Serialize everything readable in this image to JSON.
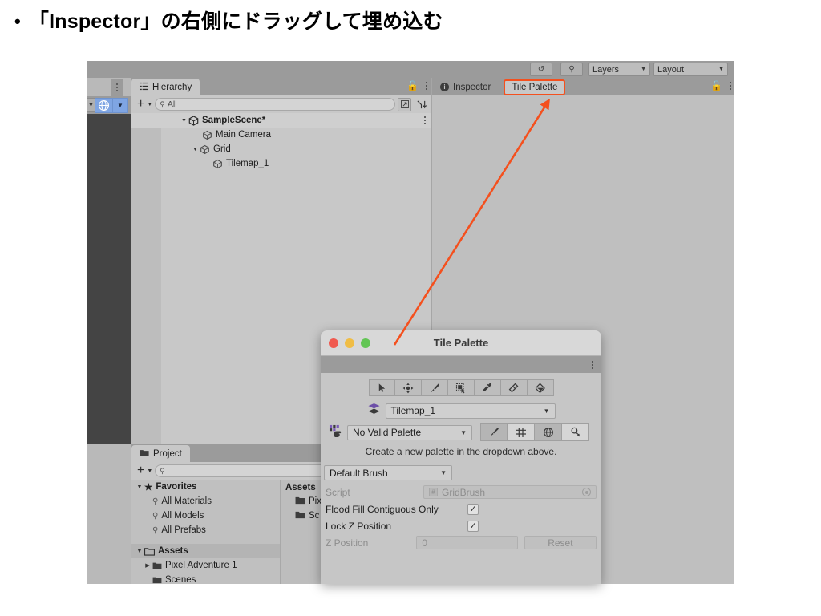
{
  "slide": {
    "bullet": "•",
    "heading": "「Inspector」の右側にドラッグして埋め込む"
  },
  "colors": {
    "highlight": "#f4501e",
    "panel_bg": "#c8c8c8",
    "toolbar_bg": "#9b9b9b",
    "scene_bg": "#444444",
    "accent_blue": "#7fa5e3",
    "light_red": "#f05a50",
    "light_yellow": "#f0bd45",
    "light_green": "#62c554"
  },
  "toolbar": {
    "history_icon": "history-icon",
    "search_icon": "search-icon",
    "layers_label": "Layers",
    "layout_label": "Layout",
    "pivot_icon": "globe-pivot-icon"
  },
  "hierarchy": {
    "tab_label": "Hierarchy",
    "tab_icon": "hierarchy-icon",
    "add_label": "+",
    "search_value": "All",
    "search_icon": "search-icon",
    "lock_icon": "lock-open-icon",
    "menu_icon": "kebab-menu-icon",
    "rows": [
      {
        "label": "SampleScene*",
        "depth": 0,
        "expanded": true,
        "bold": true,
        "icon": "scene-icon"
      },
      {
        "label": "Main Camera",
        "depth": 1,
        "expanded": null,
        "bold": false,
        "icon": "gameobject-icon"
      },
      {
        "label": "Grid",
        "depth": 1,
        "expanded": true,
        "bold": false,
        "icon": "gameobject-icon"
      },
      {
        "label": "Tilemap_1",
        "depth": 2,
        "expanded": null,
        "bold": false,
        "icon": "gameobject-icon"
      }
    ]
  },
  "inspector": {
    "tab_label": "Inspector",
    "tab_icon": "info-icon",
    "tile_palette_tab_label": "Tile Palette",
    "lock_icon": "lock-open-icon",
    "menu_icon": "kebab-menu-icon"
  },
  "project": {
    "tab_label": "Project",
    "tab_icon": "folder-icon",
    "add_label": "+",
    "search_placeholder": "",
    "favorites": {
      "label": "Favorites",
      "icon": "star-icon",
      "items": [
        {
          "label": "All Materials",
          "icon": "search-icon"
        },
        {
          "label": "All Models",
          "icon": "search-icon"
        },
        {
          "label": "All Prefabs",
          "icon": "search-icon"
        }
      ]
    },
    "assets": {
      "label": "Assets",
      "icon": "folder-open-icon",
      "items": [
        {
          "label": "Pixel Adventure 1",
          "icon": "folder-icon",
          "expandable": true
        },
        {
          "label": "Scenes",
          "icon": "folder-icon",
          "expandable": false
        }
      ]
    },
    "assets_column": {
      "header": "Assets",
      "items": [
        {
          "label": "Pix",
          "icon": "folder-icon"
        },
        {
          "label": "Sc",
          "icon": "folder-icon"
        }
      ]
    }
  },
  "tile_palette_window": {
    "title": "Tile Palette",
    "menu_icon": "kebab-menu-icon",
    "traffic_lights": [
      "close-button",
      "minimize-button",
      "zoom-button"
    ],
    "tools": [
      "select-tool-icon",
      "move-tool-icon",
      "brush-tool-icon",
      "box-fill-tool-icon",
      "picker-tool-icon",
      "eraser-tool-icon",
      "fill-tool-icon"
    ],
    "active_tilemap": {
      "icon": "tilemap-layers-icon",
      "value": "Tilemap_1"
    },
    "palette": {
      "icon": "palette-icon",
      "value": "No Valid Palette",
      "buttons": [
        {
          "name": "edit-palette-icon",
          "active": false
        },
        {
          "name": "grid-toggle-icon",
          "active": true
        },
        {
          "name": "gizmo-toggle-icon",
          "active": false
        },
        {
          "name": "settings-icon",
          "active": true
        }
      ]
    },
    "hint": "Create a new palette in the dropdown above.",
    "brush_selector": "Default Brush",
    "properties": [
      {
        "label": "Script",
        "type": "object",
        "value": "GridBrush",
        "dimmed": true
      },
      {
        "label": "Flood Fill Contiguous Only",
        "type": "checkbox",
        "checked": true,
        "dimmed": false
      },
      {
        "label": "Lock Z Position",
        "type": "checkbox",
        "checked": true,
        "dimmed": false
      },
      {
        "label": "Z Position",
        "type": "number",
        "value": "0",
        "dimmed": true,
        "button": "Reset"
      }
    ]
  },
  "annotation": {
    "arrow_name": "red-callout-arrow",
    "highlight_box_name": "tile-palette-tab-highlight"
  }
}
